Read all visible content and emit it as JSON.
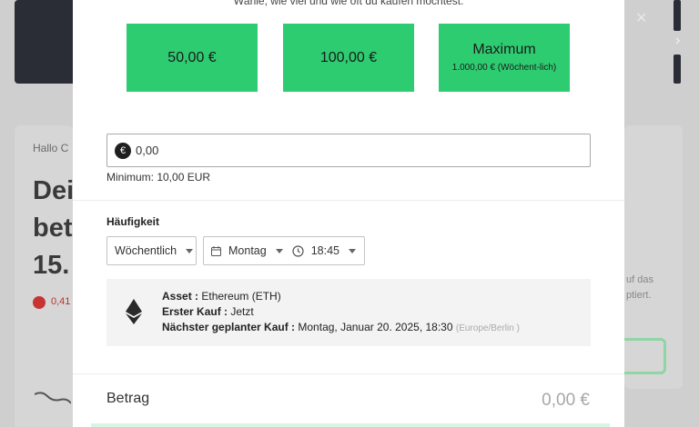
{
  "modal": {
    "top_text": "Wähle, wie viel und wie oft du kaufen möchtest.",
    "amount_options": [
      {
        "label": "50,00 €"
      },
      {
        "label": "100,00 €"
      },
      {
        "label": "Maximum",
        "sublabel": "1.000,00 € (Wöchent-lich)"
      }
    ],
    "amount_input": {
      "value": "0,00",
      "currency_symbol": "€"
    },
    "minimum_text": "Minimum: 10,00 EUR",
    "frequency": {
      "label": "Häufigkeit",
      "interval": "Wöchentlich",
      "day": "Montag",
      "time": "18:45"
    },
    "summary": {
      "asset_label": "Asset :",
      "asset_value": "Ethereum (ETH)",
      "first_label": "Erster Kauf :",
      "first_value": "Jetzt",
      "next_label": "Nächster geplanter Kauf :",
      "next_value": "Montag, Januar 20. 2025, 18:30",
      "timezone": "(Europe/Berlin )"
    },
    "total": {
      "label": "Betrag",
      "value": "0,00 €"
    }
  },
  "background": {
    "hello": "Hallo C",
    "heading_lines": [
      "Dei",
      "bet",
      "15."
    ],
    "red_text": "0,41",
    "side_text": [
      "uf das",
      "ptiert."
    ]
  },
  "colors": {
    "accent": "#2ecc71",
    "info_bg": "#f3f3f3"
  }
}
